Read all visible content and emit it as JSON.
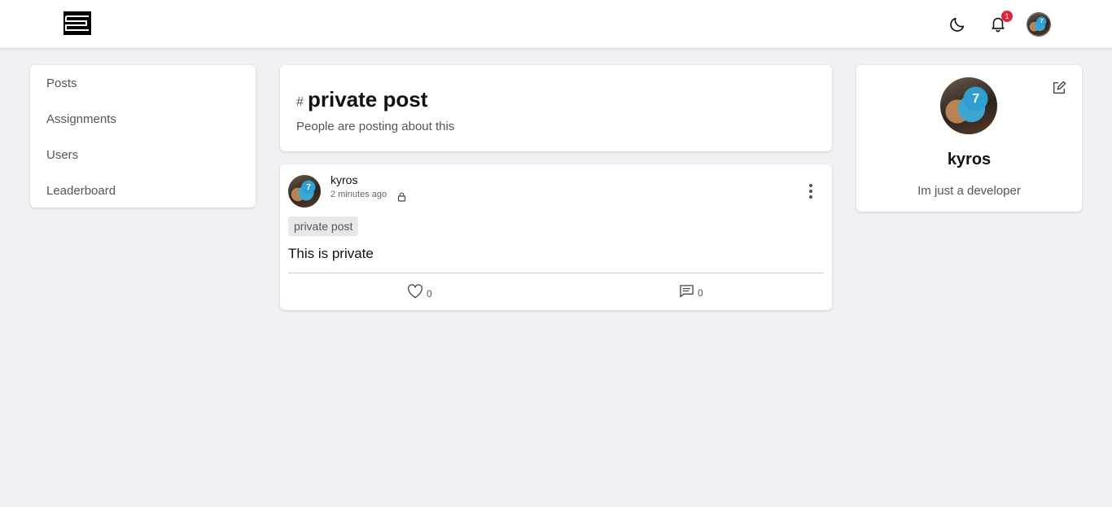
{
  "header": {
    "notification_count": "1"
  },
  "nav": {
    "items": [
      {
        "label": "Posts"
      },
      {
        "label": "Assignments"
      },
      {
        "label": "Users"
      },
      {
        "label": "Leaderboard"
      }
    ]
  },
  "tag": {
    "hash": "#",
    "title": "private post",
    "subtitle": "People are posting about this"
  },
  "post": {
    "author": "kyros",
    "time": "2 minutes ago",
    "tag": "private post",
    "body": "This is private",
    "likes": "0",
    "comments": "0"
  },
  "profile": {
    "name": "kyros",
    "bio": "Im just a developer"
  },
  "icons": [
    "logo-icon",
    "moon-icon",
    "bell-icon",
    "lock-icon",
    "more-icon",
    "heart-icon",
    "comment-icon",
    "edit-icon"
  ],
  "colors": {
    "background": "#f0f1f5",
    "badge": "#e0243f",
    "chip": "#e7e8ec"
  }
}
